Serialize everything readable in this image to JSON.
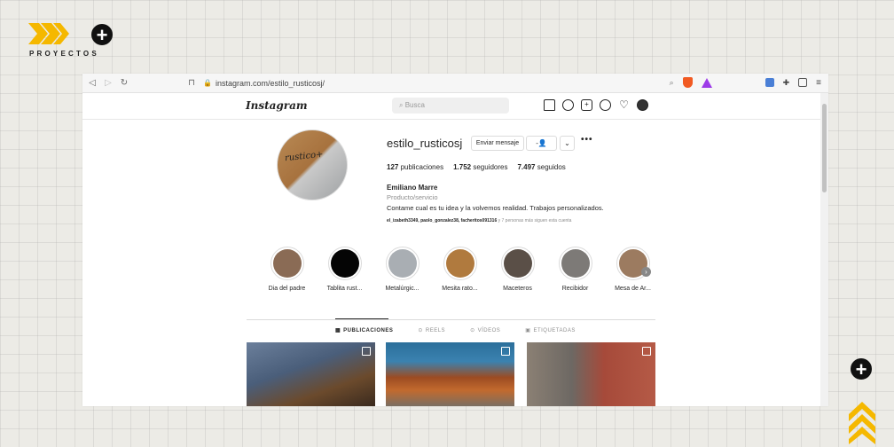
{
  "slide": {
    "brand_label": "PROYECTOS",
    "accent_color": "#f5b800"
  },
  "browser": {
    "url": "instagram.com/estilo_rusticosj/"
  },
  "instagram": {
    "logo": "Instagram",
    "search_placeholder": "Busca",
    "nav_icons": [
      "home-icon",
      "messenger-icon",
      "new-post-icon",
      "explore-icon",
      "activity-heart-icon",
      "profile-avatar-icon"
    ],
    "profile": {
      "username": "estilo_rusticosj",
      "message_button": "Enviar mensaje",
      "follow_icon": "✓●",
      "more": "•••",
      "posts": "127",
      "posts_label": "publicaciones",
      "followers": "1.752",
      "followers_label": "seguidores",
      "following": "7.497",
      "following_label": "seguidos",
      "full_name": "Emiliano Marre",
      "category": "Producto/servicio",
      "bio": "Contame cual es tu idea y la volvemos realidad. Trabajos personalizados.",
      "followed_by": "el_izabeth3349, paolo_gonzalez38, facheritos091316",
      "followed_by_rest": "y 7 personas más siguen esta cuenta",
      "avatar_text": "rustico+"
    },
    "highlights": [
      {
        "label": "Dia del padre",
        "color": "#8a6b55"
      },
      {
        "label": "Tablita rust...",
        "color": "#050505"
      },
      {
        "label": "Metalúrgic...",
        "color": "#a9aeb3"
      },
      {
        "label": "Mesita rato...",
        "color": "#b07a3e"
      },
      {
        "label": "Maceteros",
        "color": "#5a4f47"
      },
      {
        "label": "Recibidor",
        "color": "#7d7a77"
      },
      {
        "label": "Mesa de Ar...",
        "color": "#9c7b60"
      }
    ],
    "tabs": [
      {
        "label": "PUBLICACIONES",
        "icon": "▦"
      },
      {
        "label": "REELS",
        "icon": "⊙"
      },
      {
        "label": "VÍDEOS",
        "icon": "⊙"
      },
      {
        "label": "ETIQUETADAS",
        "icon": "▣"
      }
    ]
  }
}
